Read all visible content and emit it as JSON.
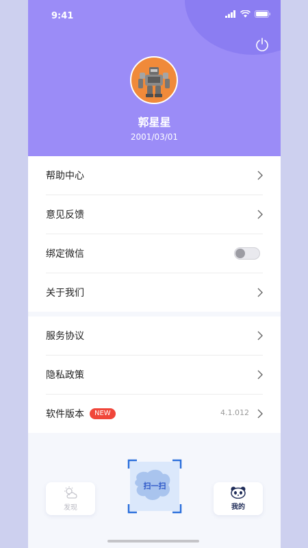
{
  "status_bar": {
    "time": "9:41"
  },
  "profile": {
    "name": "郭星星",
    "birth_date": "2001/03/01"
  },
  "menu_group_1": [
    {
      "label": "帮助中心",
      "control": "chevron"
    },
    {
      "label": "意见反馈",
      "control": "chevron"
    },
    {
      "label": "绑定微信",
      "control": "toggle",
      "toggle_on": false
    },
    {
      "label": "关于我们",
      "control": "chevron"
    }
  ],
  "menu_group_2": [
    {
      "label": "服务协议",
      "control": "chevron"
    },
    {
      "label": "隐私政策",
      "control": "chevron"
    },
    {
      "label": "软件版本",
      "control": "chevron",
      "badge": "NEW",
      "value": "4.1.012"
    }
  ],
  "tab_bar": {
    "discover_label": "发现",
    "scan_label": "扫一扫",
    "mine_label": "我的"
  },
  "colors": {
    "header_bg": "#9b8cf7",
    "badge_bg": "#f0463a",
    "scan_accent": "#2a6fdb",
    "page_bg": "#cdd0ef"
  }
}
